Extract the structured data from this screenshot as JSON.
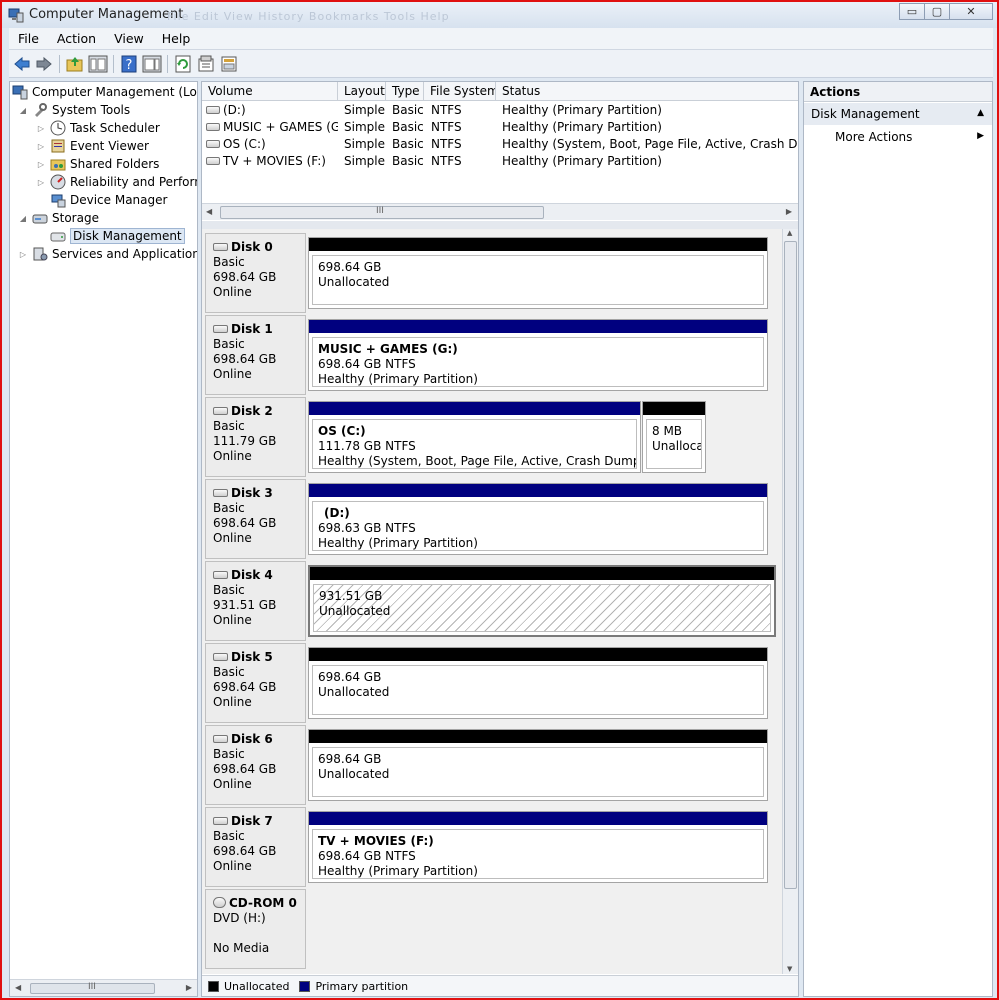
{
  "window": {
    "title": "Computer Management",
    "ghost_menu": "File  Edit  View  History  Bookmarks  Tools  Help"
  },
  "window_controls": {
    "minimize": "▭",
    "maximize": "▢",
    "close": "✕"
  },
  "menu": [
    "File",
    "Action",
    "View",
    "Help"
  ],
  "toolbar": {
    "icons": [
      "back-arrow-icon",
      "forward-arrow-icon",
      "up-folder-icon",
      "show-hide-console-tree-icon",
      "help-icon",
      "console-view-icon",
      "refresh-icon",
      "properties-icon",
      "export-icon"
    ]
  },
  "tree": {
    "root": "Computer Management (Local",
    "items": [
      {
        "label": "System Tools",
        "icon": "tools-icon"
      },
      {
        "label": "Task Scheduler",
        "icon": "clock-icon"
      },
      {
        "label": "Event Viewer",
        "icon": "event-viewer-icon"
      },
      {
        "label": "Shared Folders",
        "icon": "shared-folder-icon"
      },
      {
        "label": "Reliability and Performa",
        "icon": "performance-icon"
      },
      {
        "label": "Device Manager",
        "icon": "device-manager-icon"
      },
      {
        "label": "Storage",
        "icon": "storage-icon"
      },
      {
        "label": "Disk Management",
        "icon": "disk-icon"
      },
      {
        "label": "Services and Applications",
        "icon": "services-icon"
      }
    ],
    "scroll_thumb": "III"
  },
  "volume_list": {
    "columns": [
      "Volume",
      "Layout",
      "Type",
      "File System",
      "Status"
    ],
    "rows": [
      {
        "volume": "(D:)",
        "layout": "Simple",
        "type": "Basic",
        "fs": "NTFS",
        "status": "Healthy (Primary Partition)"
      },
      {
        "volume": "MUSIC + GAMES (G:)",
        "layout": "Simple",
        "type": "Basic",
        "fs": "NTFS",
        "status": "Healthy (Primary Partition)"
      },
      {
        "volume": "OS (C:)",
        "layout": "Simple",
        "type": "Basic",
        "fs": "NTFS",
        "status": "Healthy (System, Boot, Page File, Active, Crash Dump, P"
      },
      {
        "volume": "TV + MOVIES (F:)",
        "layout": "Simple",
        "type": "Basic",
        "fs": "NTFS",
        "status": "Healthy (Primary Partition)"
      }
    ],
    "scroll_thumb": "III"
  },
  "disks": [
    {
      "name": "Disk 0",
      "type": "Basic",
      "size": "698.64 GB",
      "status": "Online",
      "partitions": [
        {
          "title": "",
          "line1": "698.64 GB",
          "line2": "Unallocated",
          "kind": "unallocated"
        }
      ]
    },
    {
      "name": "Disk 1",
      "type": "Basic",
      "size": "698.64 GB",
      "status": "Online",
      "partitions": [
        {
          "title": "MUSIC + GAMES  (G:)",
          "line1": "698.64 GB NTFS",
          "line2": "Healthy (Primary Partition)",
          "kind": "primary"
        }
      ]
    },
    {
      "name": "Disk 2",
      "type": "Basic",
      "size": "111.79 GB",
      "status": "Online",
      "partitions": [
        {
          "title": "OS  (C:)",
          "line1": "111.78 GB NTFS",
          "line2": "Healthy (System, Boot, Page File, Active, Crash Dump, Prima",
          "kind": "primary"
        },
        {
          "title": "",
          "line1": "8 MB",
          "line2": "Unallocat",
          "kind": "unallocated"
        }
      ]
    },
    {
      "name": "Disk 3",
      "type": "Basic",
      "size": "698.64 GB",
      "status": "Online",
      "partitions": [
        {
          "title": "(D:)",
          "line1": "698.63 GB NTFS",
          "line2": "Healthy (Primary Partition)",
          "kind": "primary"
        }
      ]
    },
    {
      "name": "Disk 4",
      "type": "Basic",
      "size": "931.51 GB",
      "status": "Online",
      "partitions": [
        {
          "title": "",
          "line1": "931.51 GB",
          "line2": "Unallocated",
          "kind": "unallocated-selected"
        }
      ]
    },
    {
      "name": "Disk 5",
      "type": "Basic",
      "size": "698.64 GB",
      "status": "Online",
      "partitions": [
        {
          "title": "",
          "line1": "698.64 GB",
          "line2": "Unallocated",
          "kind": "unallocated"
        }
      ]
    },
    {
      "name": "Disk 6",
      "type": "Basic",
      "size": "698.64 GB",
      "status": "Online",
      "partitions": [
        {
          "title": "",
          "line1": "698.64 GB",
          "line2": "Unallocated",
          "kind": "unallocated"
        }
      ]
    },
    {
      "name": "Disk 7",
      "type": "Basic",
      "size": "698.64 GB",
      "status": "Online",
      "partitions": [
        {
          "title": "TV + MOVIES  (F:)",
          "line1": "698.64 GB NTFS",
          "line2": "Healthy (Primary Partition)",
          "kind": "primary"
        }
      ]
    }
  ],
  "cdrom": {
    "name": "CD-ROM 0",
    "type": "DVD (H:)",
    "status": "No Media"
  },
  "legend": {
    "unallocated": "Unallocated",
    "primary": "Primary partition"
  },
  "actions": {
    "title": "Actions",
    "section": "Disk Management",
    "more": "More Actions"
  },
  "colors": {
    "unallocated_bar": "#000000",
    "primary_bar": "#00007f",
    "frame": "#e01010"
  }
}
